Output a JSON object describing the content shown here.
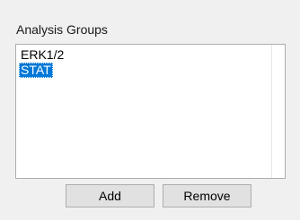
{
  "groupbox": {
    "title": "Analysis Groups"
  },
  "list": {
    "items": [
      {
        "label": "ERK1/2",
        "selected": false
      },
      {
        "label": "STAT",
        "selected": true
      }
    ]
  },
  "buttons": {
    "add_label": "Add",
    "remove_label": "Remove"
  },
  "colors": {
    "selection": "#0078d7",
    "button_face": "#e1e1e1",
    "window_bg": "#f0f0f0"
  }
}
